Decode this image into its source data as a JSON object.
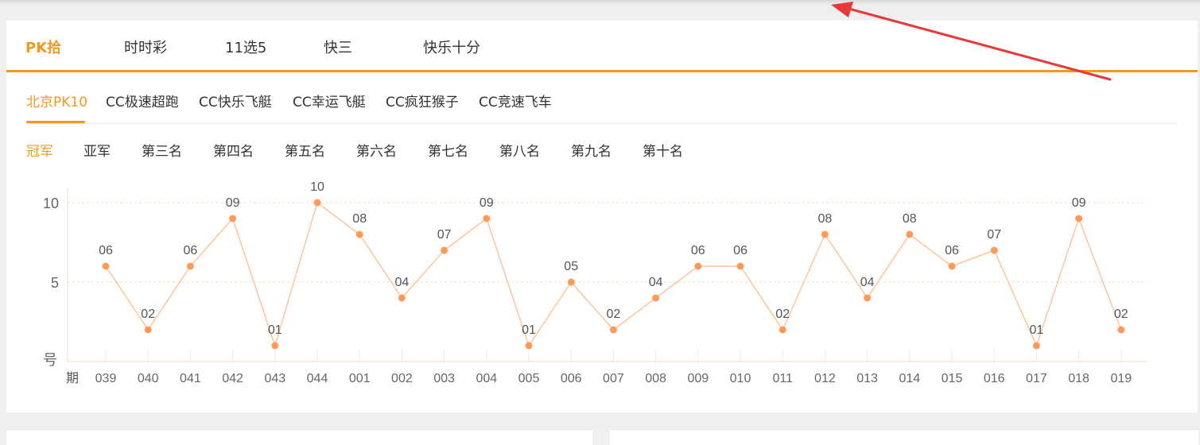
{
  "tabs_level1": [
    {
      "label": "PK拾",
      "active": true
    },
    {
      "label": "时时彩",
      "active": false
    },
    {
      "label": "11选5",
      "active": false
    },
    {
      "label": "快三",
      "active": false
    },
    {
      "label": "快乐十分",
      "active": false
    }
  ],
  "tabs_level2": [
    {
      "label": "北京PK10",
      "active": true
    },
    {
      "label": "CC极速超跑",
      "active": false
    },
    {
      "label": "CC快乐飞艇",
      "active": false
    },
    {
      "label": "CC幸运飞艇",
      "active": false
    },
    {
      "label": "CC疯狂猴子",
      "active": false
    },
    {
      "label": "CC竞速飞车",
      "active": false
    }
  ],
  "tabs_level3": [
    {
      "label": "冠军",
      "active": true
    },
    {
      "label": "亚军",
      "active": false
    },
    {
      "label": "第三名",
      "active": false
    },
    {
      "label": "第四名",
      "active": false
    },
    {
      "label": "第五名",
      "active": false
    },
    {
      "label": "第六名",
      "active": false
    },
    {
      "label": "第七名",
      "active": false
    },
    {
      "label": "第八名",
      "active": false
    },
    {
      "label": "第九名",
      "active": false
    },
    {
      "label": "第十名",
      "active": false
    }
  ],
  "colors": {
    "accent": "#f29a1f",
    "line": "#ffc49a",
    "point": "#ff9a5c",
    "arrow": "#e8393a"
  },
  "chart_data": {
    "type": "line",
    "xlabel": "期",
    "ylabel": "号",
    "x": [
      "039",
      "040",
      "041",
      "042",
      "043",
      "044",
      "001",
      "002",
      "003",
      "004",
      "005",
      "006",
      "007",
      "008",
      "009",
      "010",
      "011",
      "012",
      "013",
      "014",
      "015",
      "016",
      "017",
      "018",
      "019"
    ],
    "values": [
      6,
      2,
      6,
      9,
      1,
      10,
      8,
      4,
      7,
      9,
      1,
      5,
      2,
      4,
      6,
      6,
      2,
      8,
      4,
      8,
      6,
      7,
      1,
      9,
      2
    ],
    "data_labels": [
      "06",
      "02",
      "06",
      "09",
      "01",
      "10",
      "08",
      "04",
      "07",
      "09",
      "01",
      "05",
      "02",
      "04",
      "06",
      "06",
      "02",
      "08",
      "04",
      "08",
      "06",
      "07",
      "01",
      "09",
      "02"
    ],
    "y_ticks": [
      "10",
      "5"
    ],
    "ylim": [
      0,
      10
    ],
    "grid": "horizontal dashed"
  }
}
